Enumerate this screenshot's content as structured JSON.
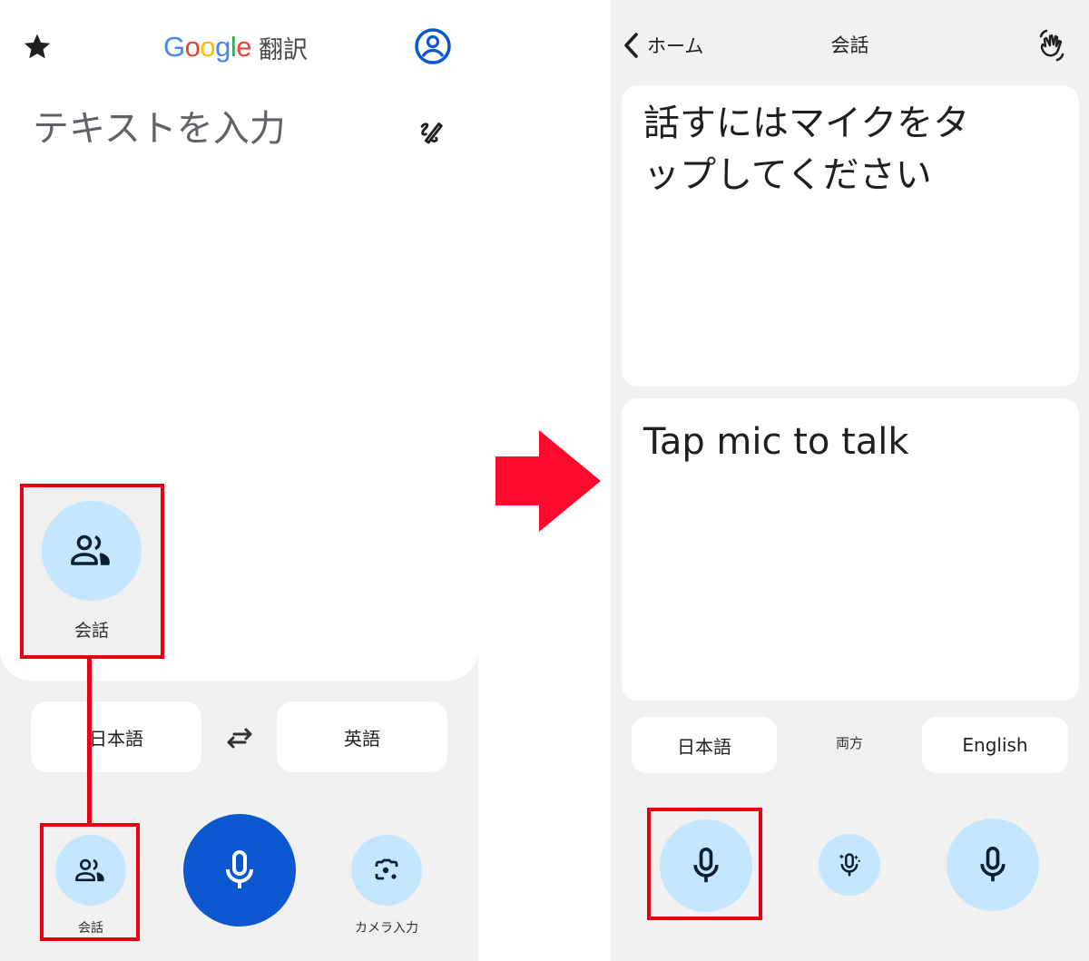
{
  "colors": {
    "accent_blue": "#0b57d0",
    "light_blue": "#c4e7ff",
    "annotation_red": "#e60012",
    "background_gray": "#f1f1f1"
  },
  "left_screen": {
    "header": {
      "favorites_icon": "star-icon",
      "brand_letters": [
        {
          "char": "G",
          "color": "#4285F4"
        },
        {
          "char": "o",
          "color": "#EA4335"
        },
        {
          "char": "o",
          "color": "#FBBC05"
        },
        {
          "char": "g",
          "color": "#4285F4"
        },
        {
          "char": "l",
          "color": "#34A853"
        },
        {
          "char": "e",
          "color": "#EA4335"
        }
      ],
      "title_suffix": "翻訳",
      "account_icon": "account-circle-icon"
    },
    "input": {
      "placeholder": "テキストを入力",
      "value": "",
      "handwriting_icon": "handwriting-icon"
    },
    "conversation_popup": {
      "icon": "people-icon",
      "label": "会話"
    },
    "language_bar": {
      "source": "日本語",
      "swap_icon": "swap-arrows-icon",
      "target": "英語"
    },
    "tools": [
      {
        "id": "conversation",
        "icon": "people-icon",
        "label": "会話"
      },
      {
        "id": "voice",
        "icon": "mic-icon",
        "label": ""
      },
      {
        "id": "camera",
        "icon": "camera-lens-icon",
        "label": "カメラ入力"
      }
    ]
  },
  "transition_arrow": "right-arrow",
  "right_screen": {
    "header": {
      "back_label": "ホーム",
      "title": "会話",
      "wave_icon": "waving-hand-icon"
    },
    "top_card_text": "話すにはマイクをタップしてください",
    "bottom_card_text": "Tap mic to talk",
    "language_bar": {
      "left": "日本語",
      "middle": "両方",
      "right": "English"
    },
    "mics": [
      {
        "id": "japanese-mic",
        "icon": "mic-icon"
      },
      {
        "id": "auto-mic",
        "icon": "auto-mic-sparkle-icon"
      },
      {
        "id": "english-mic",
        "icon": "mic-icon"
      }
    ]
  }
}
